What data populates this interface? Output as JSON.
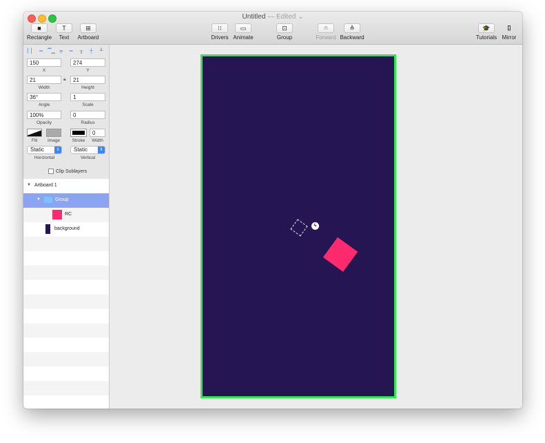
{
  "window": {
    "title": "Untitled",
    "status": "— Edited ⌄",
    "traffic_lights": [
      "close",
      "minimize",
      "maximize"
    ]
  },
  "toolbar": {
    "rectangle": {
      "label": "Rectangle",
      "icon": "■"
    },
    "text": {
      "label": "Text",
      "icon": "T"
    },
    "artboard": {
      "label": "Artboard",
      "icon": "⊞"
    },
    "drivers": {
      "label": "Drivers",
      "icon": "⁝⁝"
    },
    "animate": {
      "label": "Animate",
      "icon": "▭"
    },
    "group": {
      "label": "Group",
      "icon": "⊡"
    },
    "forward": {
      "label": "Forward",
      "icon": "≘",
      "disabled": true
    },
    "backward": {
      "label": "Backward",
      "icon": "≙"
    },
    "tutorials": {
      "label": "Tutorials",
      "icon": "🎓"
    },
    "mirror": {
      "label": "Mirror",
      "icon": "▯"
    }
  },
  "inspector": {
    "x": {
      "value": "150",
      "label": "X"
    },
    "y": {
      "value": "274",
      "label": "Y"
    },
    "width": {
      "value": "21",
      "label": "Width"
    },
    "height": {
      "value": "21",
      "label": "Height"
    },
    "angle": {
      "value": "36°",
      "label": "Angle"
    },
    "scale": {
      "value": "1",
      "label": "Scale"
    },
    "opacity": {
      "value": "100%",
      "label": "Opacity"
    },
    "radius": {
      "value": "0",
      "label": "Radius"
    },
    "fill": {
      "label": "Fill"
    },
    "image": {
      "label": "Image"
    },
    "stroke": {
      "label": "Stroke"
    },
    "stroke_width": {
      "value": "0",
      "label": "Width"
    },
    "horizontal": {
      "value": "Static",
      "label": "Horizontal"
    },
    "vertical": {
      "value": "Static",
      "label": "Vertical"
    },
    "clip_sublayers": {
      "label": "Clip Sublayers",
      "checked": false
    }
  },
  "layers": [
    {
      "name": "Artboard 1",
      "depth": 0,
      "expanded": true
    },
    {
      "name": "Group",
      "depth": 1,
      "expanded": true,
      "selected": true
    },
    {
      "name": "RC",
      "depth": 2,
      "swatch": "#fd2a6e"
    },
    {
      "name": "background",
      "depth": 1,
      "swatch": "#261553"
    }
  ],
  "canvas": {
    "artboard_color": "#261553",
    "artboard_border": "#2dea4b",
    "rc_color": "#fd2a6e",
    "rc_angle_deg": 36
  }
}
